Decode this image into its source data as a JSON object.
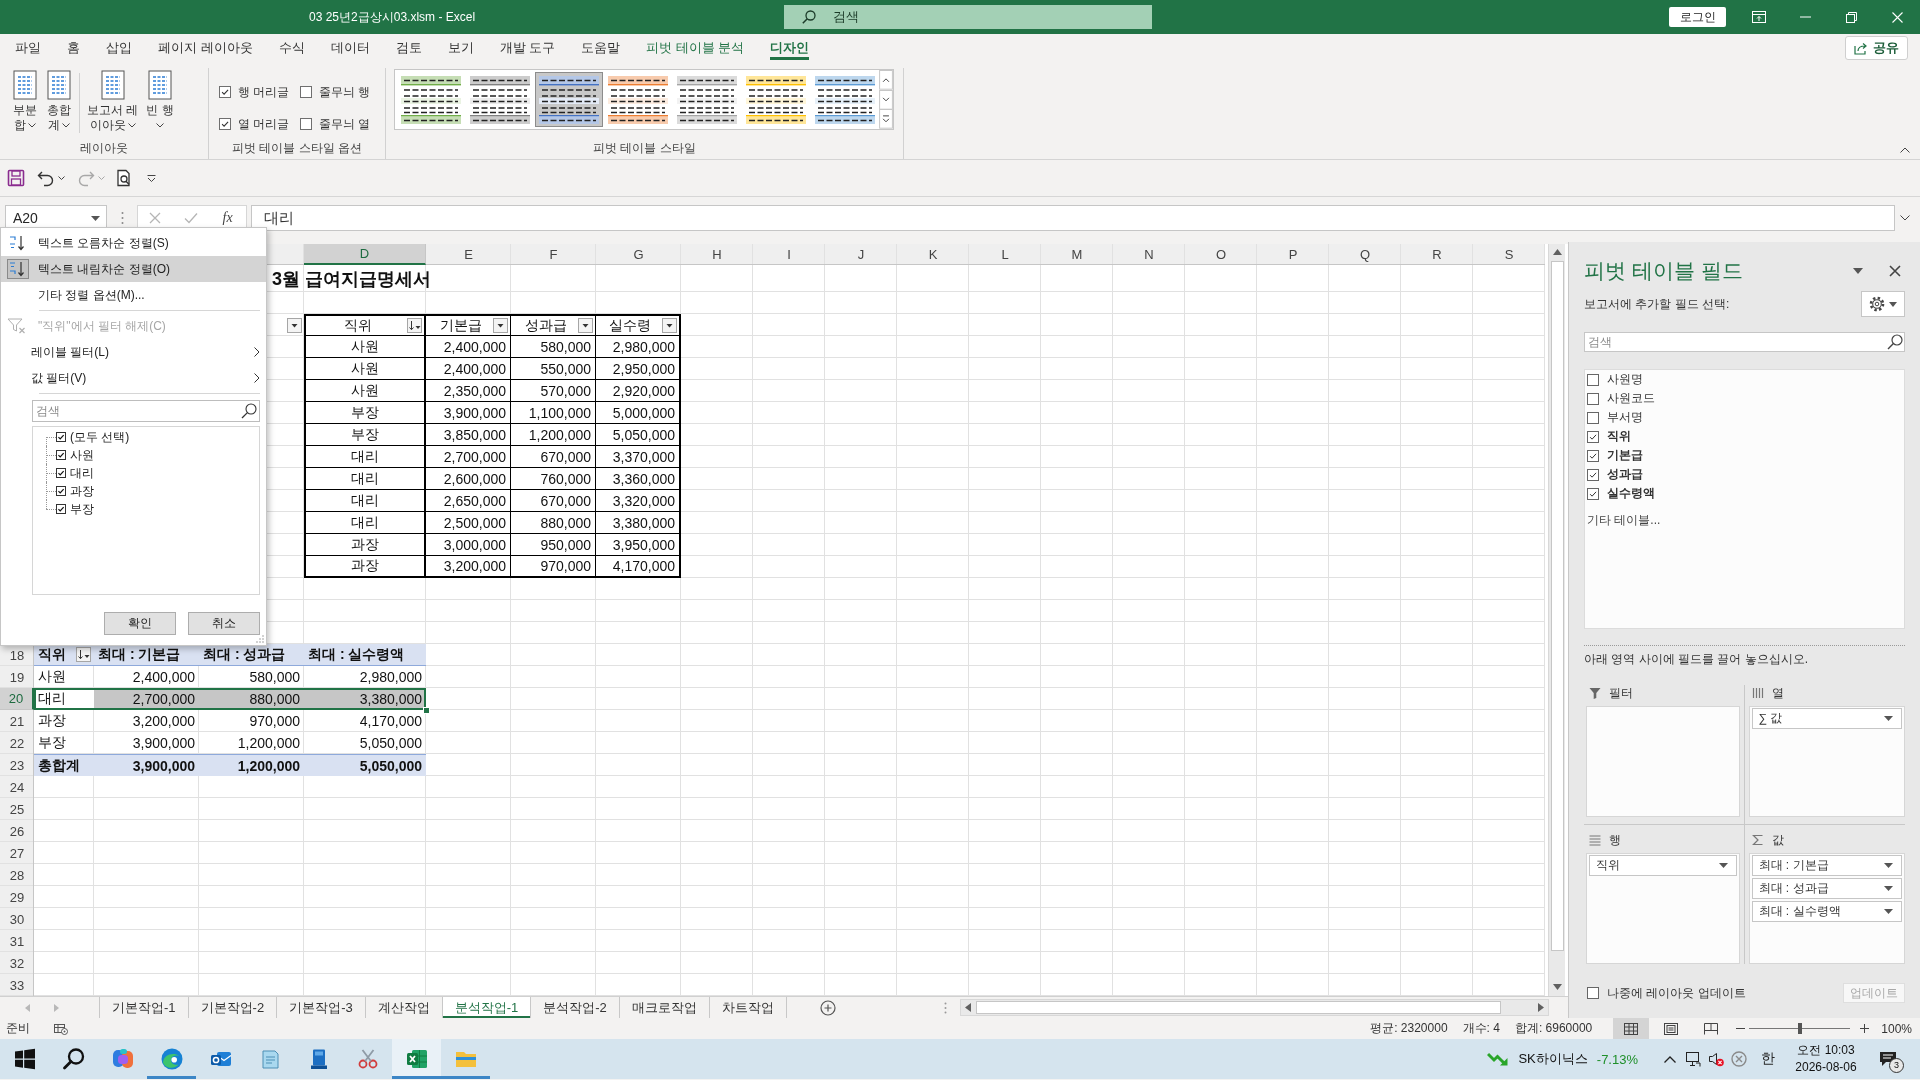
{
  "window": {
    "title": "03 25년2급상시03.xlsm - Excel",
    "search_placeholder": "검색",
    "login_button": "로그인"
  },
  "ribbon_tabs": [
    {
      "label": "파일",
      "kind": "standard",
      "selected": false
    },
    {
      "label": "홈",
      "kind": "standard",
      "selected": false
    },
    {
      "label": "삽입",
      "kind": "standard",
      "selected": false
    },
    {
      "label": "페이지 레이아웃",
      "kind": "standard",
      "selected": false
    },
    {
      "label": "수식",
      "kind": "standard",
      "selected": false
    },
    {
      "label": "데이터",
      "kind": "standard",
      "selected": false
    },
    {
      "label": "검토",
      "kind": "standard",
      "selected": false
    },
    {
      "label": "보기",
      "kind": "standard",
      "selected": false
    },
    {
      "label": "개발 도구",
      "kind": "standard",
      "selected": false
    },
    {
      "label": "도움말",
      "kind": "standard",
      "selected": false
    },
    {
      "label": "피벗 테이블 분석",
      "kind": "contextual",
      "selected": false
    },
    {
      "label": "디자인",
      "kind": "contextual",
      "selected": true
    }
  ],
  "share_button": "공유",
  "ribbon_groups": [
    {
      "kind": "buttons",
      "label": "레이아웃",
      "buttons": [
        {
          "lines": [
            "부분",
            "합"
          ]
        },
        {
          "lines": [
            "총합",
            "계"
          ]
        },
        {
          "lines": [
            "보고서 레",
            "이아웃"
          ]
        },
        {
          "lines": [
            "빈 행"
          ]
        }
      ]
    },
    {
      "kind": "options",
      "label": "피벗 테이블 스타일 옵션",
      "options": [
        {
          "label": "행 머리글",
          "checked": true
        },
        {
          "label": "줄무늬 행",
          "checked": false
        },
        {
          "label": "열 머리글",
          "checked": true
        },
        {
          "label": "줄무늬 열",
          "checked": false
        }
      ]
    },
    {
      "kind": "gallery",
      "label": "피벗 테이블 스타일",
      "styles": [
        {
          "color": "#70ad47",
          "selected": false
        },
        {
          "color": "#808080",
          "selected": false
        },
        {
          "color": "#4472c4",
          "selected": true
        },
        {
          "color": "#ed7d31",
          "selected": false
        },
        {
          "color": "#a5a5a5",
          "selected": false
        },
        {
          "color": "#ffc000",
          "selected": false
        },
        {
          "color": "#5b9bd5",
          "selected": false
        }
      ]
    }
  ],
  "quick_access": [
    {
      "kind": "save",
      "disabled": false
    },
    {
      "kind": "undo",
      "disabled": false
    },
    {
      "kind": "redo",
      "disabled": true
    },
    {
      "kind": "print_preview",
      "disabled": false
    }
  ],
  "formula_bar": {
    "name_box": "A20",
    "function_button": "fx",
    "formula": "대리"
  },
  "sheet": {
    "column_letters": [
      {
        "letter": "D",
        "selected": true
      },
      {
        "letter": "E",
        "selected": false
      },
      {
        "letter": "F",
        "selected": false
      },
      {
        "letter": "G",
        "selected": false
      },
      {
        "letter": "H",
        "selected": false
      },
      {
        "letter": "I",
        "selected": false
      },
      {
        "letter": "J",
        "selected": false
      },
      {
        "letter": "K",
        "selected": false
      },
      {
        "letter": "L",
        "selected": false
      },
      {
        "letter": "M",
        "selected": false
      },
      {
        "letter": "N",
        "selected": false
      },
      {
        "letter": "O",
        "selected": false
      },
      {
        "letter": "P",
        "selected": false
      },
      {
        "letter": "Q",
        "selected": false
      },
      {
        "letter": "R",
        "selected": false
      },
      {
        "letter": "S",
        "selected": false
      }
    ],
    "row_numbers": [
      {
        "number": "18",
        "selected": false
      },
      {
        "number": "19",
        "selected": false
      },
      {
        "number": "20",
        "selected": true
      },
      {
        "number": "21",
        "selected": false
      },
      {
        "number": "22",
        "selected": false
      },
      {
        "number": "23",
        "selected": false
      },
      {
        "number": "24",
        "selected": false
      },
      {
        "number": "25",
        "selected": false
      },
      {
        "number": "26",
        "selected": false
      },
      {
        "number": "27",
        "selected": false
      },
      {
        "number": "28",
        "selected": false
      },
      {
        "number": "29",
        "selected": false
      },
      {
        "number": "30",
        "selected": false
      },
      {
        "number": "31",
        "selected": false
      },
      {
        "number": "32",
        "selected": false
      },
      {
        "number": "33",
        "selected": false
      }
    ],
    "title": "3월 급여지급명세서",
    "data_table": {
      "leading_filter_button": {
        "sorted": false
      },
      "columns": [
        {
          "label": "직위",
          "sorted": true
        },
        {
          "label": "기본급",
          "sorted": false
        },
        {
          "label": "성과급",
          "sorted": false
        },
        {
          "label": "실수령",
          "sorted": false
        }
      ],
      "rows": [
        [
          "사원",
          "2,400,000",
          "580,000",
          "2,980,000"
        ],
        [
          "사원",
          "2,400,000",
          "550,000",
          "2,950,000"
        ],
        [
          "사원",
          "2,350,000",
          "570,000",
          "2,920,000"
        ],
        [
          "부장",
          "3,900,000",
          "1,100,000",
          "5,000,000"
        ],
        [
          "부장",
          "3,850,000",
          "1,200,000",
          "5,050,000"
        ],
        [
          "대리",
          "2,700,000",
          "670,000",
          "3,370,000"
        ],
        [
          "대리",
          "2,600,000",
          "760,000",
          "3,360,000"
        ],
        [
          "대리",
          "2,650,000",
          "670,000",
          "3,320,000"
        ],
        [
          "대리",
          "2,500,000",
          "880,000",
          "3,380,000"
        ],
        [
          "과장",
          "3,000,000",
          "950,000",
          "3,950,000"
        ],
        [
          "과장",
          "3,200,000",
          "970,000",
          "4,170,000"
        ]
      ]
    },
    "pivot_table": {
      "row_header": {
        "label": "직위",
        "sorted": true
      },
      "value_headers": [
        "최대 : 기본급",
        "최대 : 성과급",
        "최대 : 실수령액"
      ],
      "rows": [
        {
          "label": "사원",
          "values": [
            "2,400,000",
            "580,000",
            "2,980,000"
          ],
          "selected": false
        },
        {
          "label": "대리",
          "values": [
            "2,700,000",
            "880,000",
            "3,380,000"
          ],
          "selected": true
        },
        {
          "label": "과장",
          "values": [
            "3,200,000",
            "970,000",
            "4,170,000"
          ],
          "selected": false
        },
        {
          "label": "부장",
          "values": [
            "3,900,000",
            "1,200,000",
            "5,050,000"
          ],
          "selected": false
        }
      ],
      "total": {
        "label": "총합계",
        "values": [
          "3,900,000",
          "1,200,000",
          "5,050,000"
        ]
      }
    }
  },
  "filter_menu": {
    "items": [
      {
        "kind": "sort_asc",
        "label": "텍스트 오름차순 정렬(S)",
        "selected": false,
        "disabled": false
      },
      {
        "kind": "sort_desc",
        "label": "텍스트 내림차순 정렬(O)",
        "selected": true,
        "disabled": false
      },
      {
        "kind": "option",
        "label": "기타 정렬 옵션(M)...",
        "selected": false,
        "disabled": false
      },
      {
        "kind": "clear_filter",
        "label": "\"직위\"에서 필터 해제(C)",
        "selected": false,
        "disabled": true
      },
      {
        "kind": "submenu",
        "label": "레이블 필터(L)",
        "selected": false,
        "disabled": false
      },
      {
        "kind": "submenu",
        "label": "값 필터(V)",
        "selected": false,
        "disabled": false
      }
    ],
    "search_placeholder": "검색",
    "values": [
      {
        "label": "(모두 선택)",
        "checked": true
      },
      {
        "label": "사원",
        "checked": true
      },
      {
        "label": "대리",
        "checked": true
      },
      {
        "label": "과장",
        "checked": true
      },
      {
        "label": "부장",
        "checked": true
      }
    ],
    "buttons": [
      "확인",
      "취소"
    ]
  },
  "pivot_panel": {
    "title": "피벗 테이블 필드",
    "prompt": "보고서에 추가할 필드 선택:",
    "search_placeholder": "검색",
    "fields": [
      {
        "label": "사원명",
        "checked": false
      },
      {
        "label": "사원코드",
        "checked": false
      },
      {
        "label": "부서명",
        "checked": false
      },
      {
        "label": "직위",
        "checked": true
      },
      {
        "label": "기본급",
        "checked": true
      },
      {
        "label": "성과급",
        "checked": true
      },
      {
        "label": "실수령액",
        "checked": true
      }
    ],
    "more_tables": "기타 테이블...",
    "drag_hint": "아래 영역 사이에 필드를 끌어 놓으십시오.",
    "areas": [
      {
        "kind": "filters",
        "label": "필터"
      },
      {
        "kind": "columns",
        "label": "열",
        "items": [
          "∑ 값"
        ]
      },
      {
        "kind": "rows",
        "label": "행",
        "items": [
          "직위"
        ]
      },
      {
        "kind": "values",
        "label": "값",
        "items": [
          "최대 : 기본급",
          "최대 : 성과급",
          "최대 : 실수령액"
        ]
      }
    ],
    "defer_update": {
      "label": "나중에 레이아웃 업데이트",
      "checked": false
    },
    "update_button": {
      "label": "업데이트",
      "disabled": true
    }
  },
  "sheet_tabs": [
    {
      "label": "기본작업-1",
      "selected": false
    },
    {
      "label": "기본작업-2",
      "selected": false
    },
    {
      "label": "기본작업-3",
      "selected": false
    },
    {
      "label": "계산작업",
      "selected": false
    },
    {
      "label": "분석작업-1",
      "selected": true
    },
    {
      "label": "분석작업-2",
      "selected": false
    },
    {
      "label": "매크로작업",
      "selected": false
    },
    {
      "label": "차트작업",
      "selected": false
    }
  ],
  "status_bar": {
    "mode": "준비",
    "average": "평균: 2320000",
    "count": "개수: 4",
    "sum": "합계: 6960000",
    "views": [
      {
        "kind": "normal",
        "selected": true
      },
      {
        "kind": "page_layout",
        "selected": false
      },
      {
        "kind": "page_break",
        "selected": false
      }
    ],
    "zoom": {
      "level": 0.5,
      "label": "100%"
    }
  },
  "taskbar": {
    "apps": [
      {
        "kind": "start",
        "running": false,
        "selected": false
      },
      {
        "kind": "search",
        "running": false,
        "selected": false
      },
      {
        "kind": "assistant",
        "running": false,
        "selected": false
      },
      {
        "kind": "browser",
        "running": true,
        "selected": false
      },
      {
        "kind": "mail",
        "running": false,
        "selected": false
      },
      {
        "kind": "notepad",
        "running": false,
        "selected": false
      },
      {
        "kind": "app",
        "running": false,
        "selected": false
      },
      {
        "kind": "scissors",
        "running": false,
        "selected": false
      },
      {
        "kind": "spreadsheet",
        "running": true,
        "selected": true
      },
      {
        "kind": "folder",
        "running": true,
        "selected": false
      }
    ],
    "stock": {
      "name": "SK하이닉스",
      "change": "-7.13%"
    },
    "ime": "한",
    "time": "오전 10:03",
    "date": "2026-08-06",
    "notification_count": "3"
  }
}
